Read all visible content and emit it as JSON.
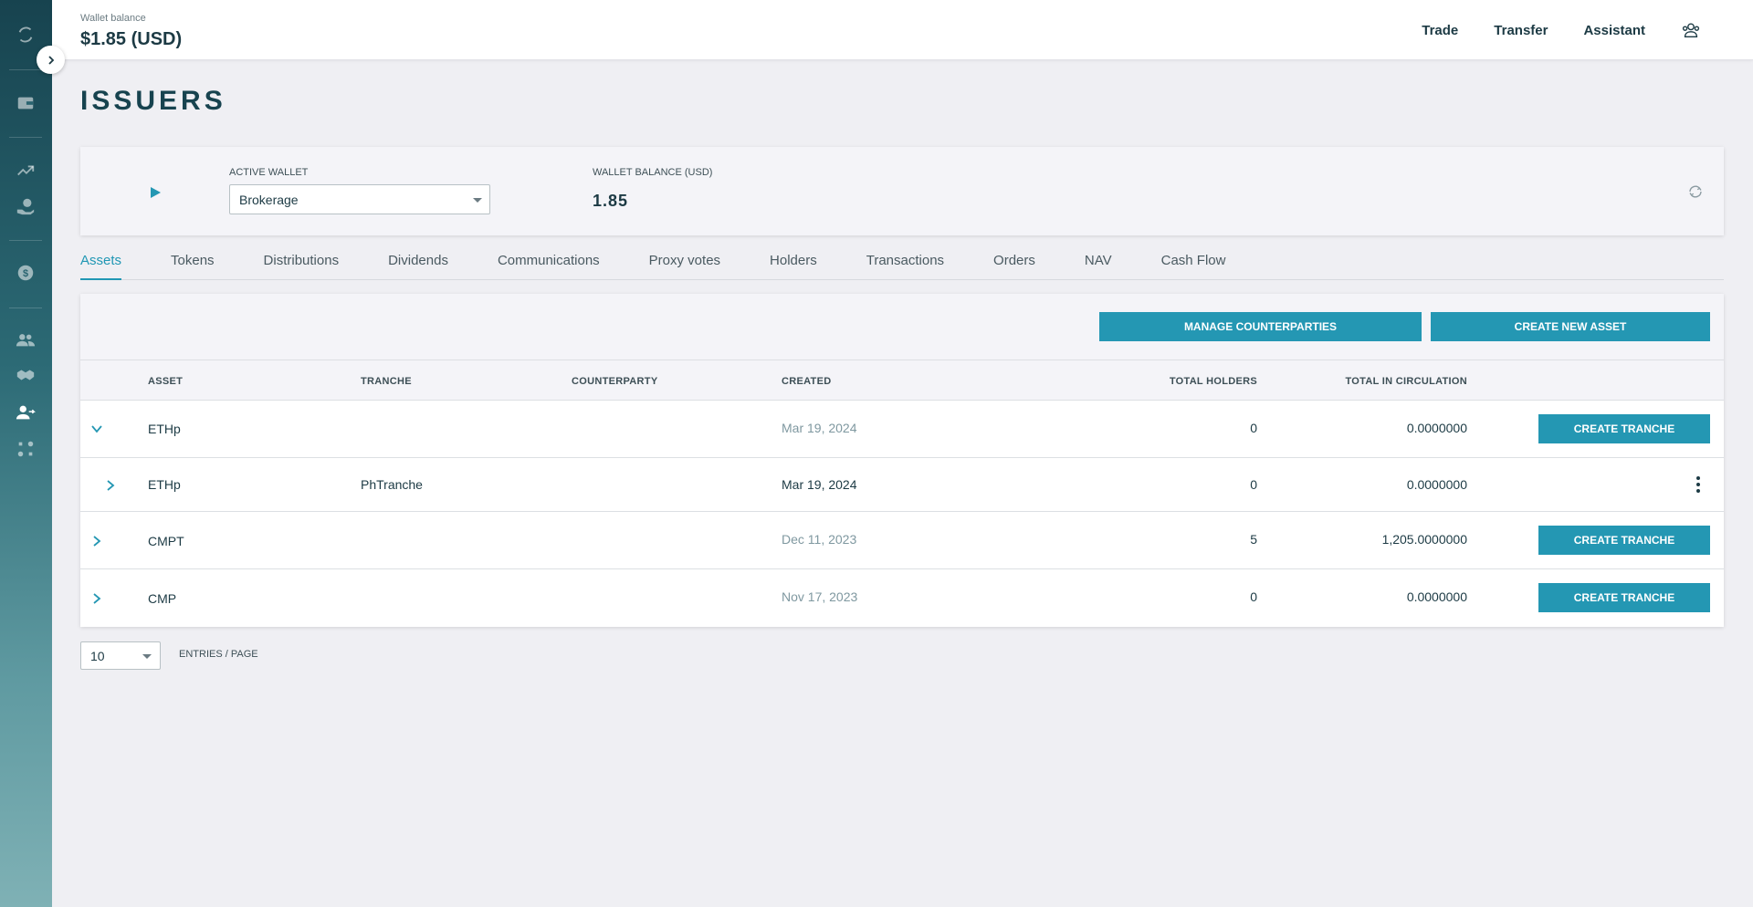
{
  "header": {
    "wallet_balance_label": "Wallet balance",
    "wallet_balance_value": "$1.85 (USD)",
    "nav": [
      "Trade",
      "Transfer",
      "Assistant"
    ]
  },
  "sidebar": {
    "icons": [
      "logo-icon",
      "wallet-icon",
      "trending-icon",
      "hand-coin-icon",
      "dollar-coin-icon",
      "users-icon",
      "handshake-icon",
      "user-transfer-icon",
      "nodes-icon"
    ]
  },
  "page": {
    "title": "ISSUERS"
  },
  "wallet_card": {
    "active_wallet_label": "ACTIVE WALLET",
    "active_wallet_value": "Brokerage",
    "balance_label": "WALLET BALANCE (USD)",
    "balance_value": "1.85"
  },
  "tabs": [
    "Assets",
    "Tokens",
    "Distributions",
    "Dividends",
    "Communications",
    "Proxy votes",
    "Holders",
    "Transactions",
    "Orders",
    "NAV",
    "Cash Flow"
  ],
  "active_tab": "Assets",
  "toolbar": {
    "manage_counterparties": "MANAGE COUNTERPARTIES",
    "create_new_asset": "CREATE NEW ASSET"
  },
  "table": {
    "headers": {
      "asset": "ASSET",
      "tranche": "TRANCHE",
      "counterparty": "COUNTERPARTY",
      "created": "CREATED",
      "total_holders": "TOTAL HOLDERS",
      "total_in_circulation": "TOTAL IN CIRCULATION"
    },
    "create_tranche_label": "CREATE TRANCHE",
    "rows": [
      {
        "asset": "ETHp",
        "tranche": "",
        "counterparty": "",
        "created": "Mar 19, 2024",
        "total_holders": "0",
        "total_in_circulation": "0.0000000",
        "expanded": true
      },
      {
        "asset": "ETHp",
        "tranche": "PhTranche",
        "counterparty": "",
        "created": "Mar 19, 2024",
        "total_holders": "0",
        "total_in_circulation": "0.0000000",
        "child": true
      },
      {
        "asset": "CMPT",
        "tranche": "",
        "counterparty": "",
        "created": "Dec 11, 2023",
        "total_holders": "5",
        "total_in_circulation": "1,205.0000000"
      },
      {
        "asset": "CMP",
        "tranche": "",
        "counterparty": "",
        "created": "Nov 17, 2023",
        "total_holders": "0",
        "total_in_circulation": "0.0000000"
      }
    ]
  },
  "pagination": {
    "page_size": "10",
    "label": "ENTRIES / PAGE"
  },
  "colors": {
    "accent": "#2497b3",
    "sidebar_top": "#17434f",
    "sidebar_bottom": "#7fb1b5",
    "text_dark": "#1c3a44"
  }
}
